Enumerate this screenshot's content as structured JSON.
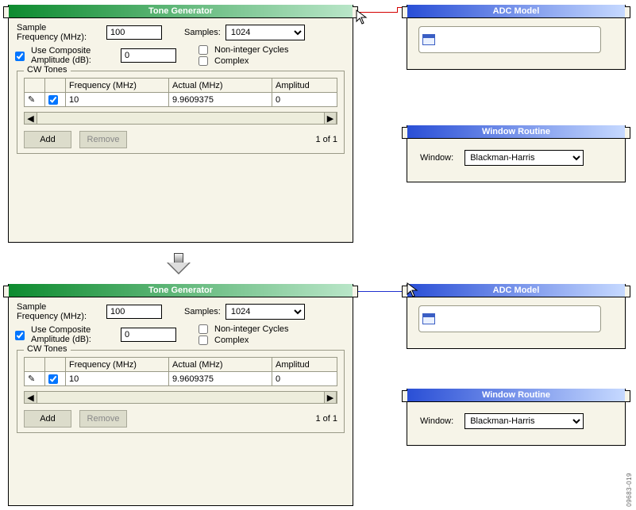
{
  "doc_id": "09683-019",
  "tone_generator": {
    "title": "Tone Generator",
    "sample_freq_label": "Sample\nFrequency (MHz):",
    "sample_freq_value": "100",
    "samples_label": "Samples:",
    "samples_value": "1024",
    "use_composite_label": "Use Composite\nAmplitude (dB):",
    "use_composite_checked": true,
    "composite_amp_value": "0",
    "non_integer_label": "Non-integer Cycles",
    "non_integer_checked": false,
    "complex_label": "Complex",
    "complex_checked": false,
    "cw_group_label": "CW Tones",
    "columns": {
      "freq": "Frequency (MHz)",
      "actual": "Actual (MHz)",
      "amp": "Amplitud"
    },
    "row": {
      "enabled": true,
      "freq": "10",
      "actual": "9.9609375",
      "amp": "0"
    },
    "add_label": "Add",
    "remove_label": "Remove",
    "page_indicator": "1 of 1"
  },
  "adc_model": {
    "title": "ADC Model"
  },
  "window_routine": {
    "title": "Window Routine",
    "window_label": "Window:",
    "window_value": "Blackman-Harris"
  }
}
